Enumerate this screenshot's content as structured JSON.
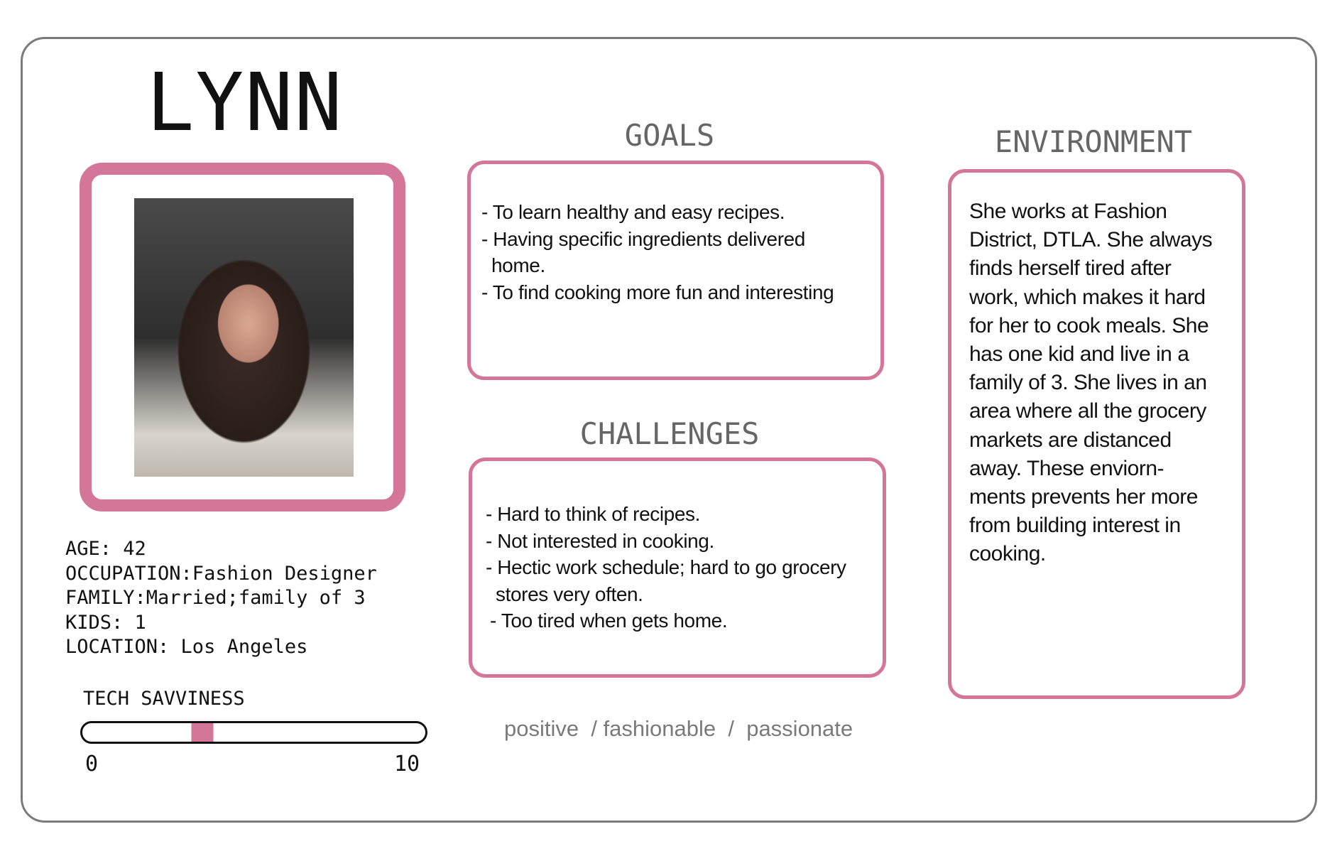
{
  "persona": {
    "name": "LYNN",
    "info": [
      "AGE: 42",
      "OCCUPATION:Fashion Designer",
      "FAMILY:Married;family of 3",
      "KIDS: 1",
      "LOCATION: Los Angeles"
    ],
    "tech_savviness": {
      "label": "TECH SAVVINESS",
      "min_label": "0",
      "max_label": "10",
      "min": 0,
      "max": 10,
      "value": 3.5
    }
  },
  "goals": {
    "title": "GOALS",
    "lines": [
      "- To learn healthy and easy recipes.",
      "- Having specific ingredients delivered",
      "home.",
      "- To find cooking more fun and interesting"
    ]
  },
  "challenges": {
    "title": "CHALLENGES",
    "lines": [
      "- Hard to think of recipes.",
      "- Not interested in cooking.",
      "- Hectic work schedule; hard to go grocery",
      "stores very often.",
      "- Too tired when gets home."
    ]
  },
  "environment": {
    "title": "ENVIRONMENT",
    "lines": [
      "She works at Fashion",
      "District, DTLA. She always",
      "finds herself tired after",
      "work, which makes it hard",
      "for her to cook meals. She",
      "has one kid and live in a",
      "family of 3. She lives in an",
      "area where all the grocery",
      "markets are distanced",
      "away. These enviorn-",
      "ments prevents her more",
      "from building interest in",
      "cooking."
    ]
  },
  "traits": {
    "text": "positive  / fashionable  /  passionate"
  },
  "colors": {
    "accent": "#d4769a",
    "border": "#7a7a7a",
    "title": "#666666"
  }
}
